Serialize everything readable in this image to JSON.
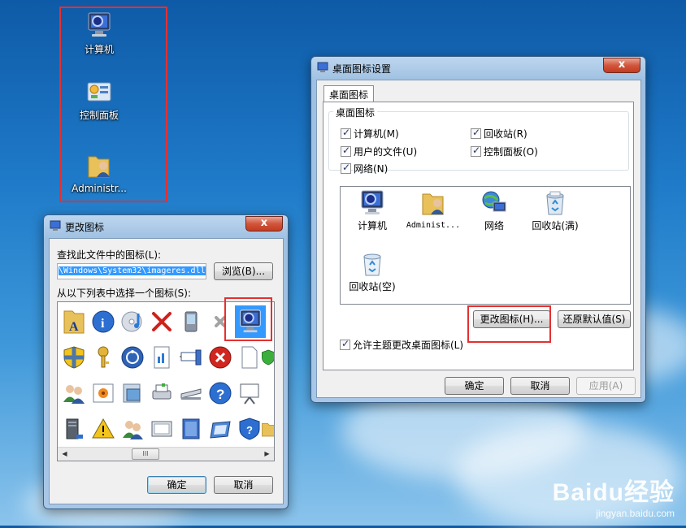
{
  "desktop": {
    "icons": [
      {
        "label": "计算机",
        "icon": "computer-icon"
      },
      {
        "label": "控制面板",
        "icon": "control-panel-icon"
      },
      {
        "label": "Administr...",
        "icon": "user-folder-icon"
      }
    ]
  },
  "change_icon_dialog": {
    "title": "更改图标",
    "close": "x",
    "search_label": "查找此文件中的图标(L):",
    "path_value": "\\Windows\\System32\\imageres.dll",
    "browse_button": "浏览(B)...",
    "list_label": "从以下列表中选择一个图标(S):",
    "ok_button": "确定",
    "cancel_button": "取消",
    "scroll_thumb": "III"
  },
  "desktop_icon_settings": {
    "title": "桌面图标设置",
    "close": "x",
    "tab": "桌面图标",
    "group_title": "桌面图标",
    "checkboxes": [
      {
        "label": "计算机(M)",
        "checked": true
      },
      {
        "label": "回收站(R)",
        "checked": true
      },
      {
        "label": "用户的文件(U)",
        "checked": true
      },
      {
        "label": "控制面板(O)",
        "checked": true
      },
      {
        "label": "网络(N)",
        "checked": true
      }
    ],
    "preview_items": [
      {
        "label": "计算机",
        "icon": "computer-icon"
      },
      {
        "label": "Administ...",
        "icon": "user-folder-icon"
      },
      {
        "label": "网络",
        "icon": "network-icon"
      },
      {
        "label": "回收站(满)",
        "icon": "recycle-bin-full-icon"
      },
      {
        "label": "回收站(空)",
        "icon": "recycle-bin-empty-icon"
      }
    ],
    "change_icon_button": "更改图标(H)...",
    "restore_default_button": "还原默认值(S)",
    "allow_themes_label": "允许主题更改桌面图标(L)",
    "ok_button": "确定",
    "cancel_button": "取消",
    "apply_button": "应用(A)"
  },
  "watermark": {
    "main": "Baidu经验",
    "sub": "jingyan.baidu.com"
  },
  "colors": {
    "highlight_box": "#e53030",
    "selection": "#3399ff"
  }
}
